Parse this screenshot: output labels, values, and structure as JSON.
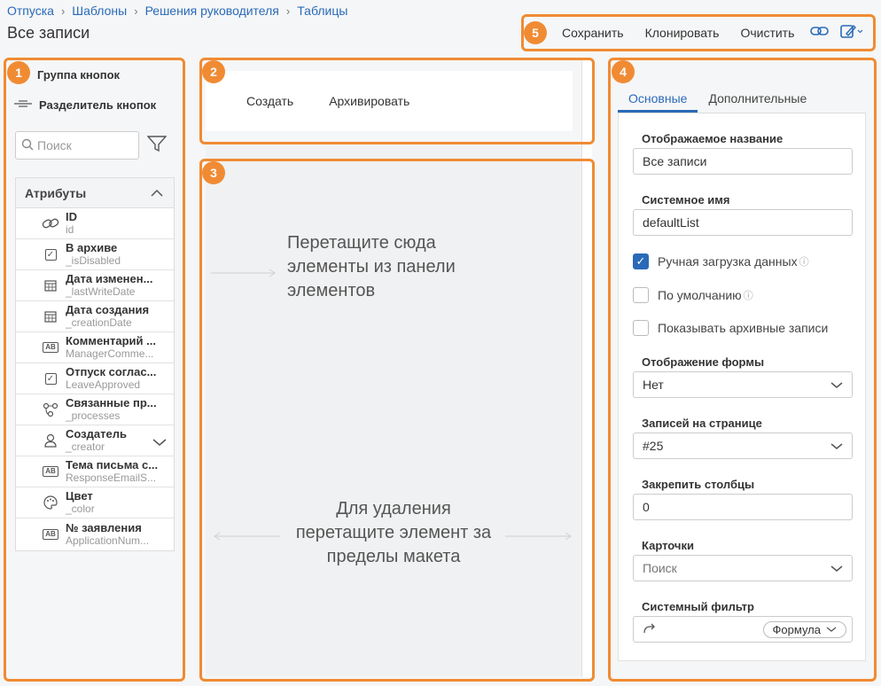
{
  "breadcrumb": [
    "Отпуска",
    "Шаблоны",
    "Решения руководителя",
    "Таблицы"
  ],
  "page_title": "Все записи",
  "toolbar": {
    "save": "Сохранить",
    "clone": "Клонировать",
    "clear": "Очистить"
  },
  "badges": [
    "1",
    "2",
    "3",
    "4",
    "5"
  ],
  "left": {
    "button_group": "Группа кнопок",
    "button_separator": "Разделитель кнопок",
    "search_placeholder": "Поиск",
    "attributes_title": "Атрибуты",
    "attributes": [
      {
        "name": "ID",
        "sys": "id",
        "icon": "link-icon"
      },
      {
        "name": "В архиве",
        "sys": "_isDisabled",
        "icon": "checkbox-icon"
      },
      {
        "name": "Дата изменен...",
        "sys": "_lastWriteDate",
        "icon": "calendar-icon"
      },
      {
        "name": "Дата создания",
        "sys": "_creationDate",
        "icon": "calendar-icon"
      },
      {
        "name": "Комментарий ...",
        "sys": "ManagerComme...",
        "icon": "text-ab-icon"
      },
      {
        "name": "Отпуск соглас...",
        "sys": "LeaveApproved",
        "icon": "checkbox-icon"
      },
      {
        "name": "Связанные пр...",
        "sys": "_processes",
        "icon": "process-icon"
      },
      {
        "name": "Создатель",
        "sys": "_creator",
        "icon": "user-icon"
      },
      {
        "name": "Тема письма с...",
        "sys": "ResponseEmailS...",
        "icon": "text-ab-icon"
      },
      {
        "name": "Цвет",
        "sys": "_color",
        "icon": "palette-icon"
      },
      {
        "name": "№ заявления",
        "sys": "ApplicationNum...",
        "icon": "text-ab-icon"
      }
    ]
  },
  "middle": {
    "buttons": [
      "Создать",
      "Архивировать"
    ],
    "drop_hint": "Перетащите сюда элементы из панели элементов",
    "drop_hint_lines": [
      "Перетащите сюда",
      "элементы из панели",
      "элементов"
    ],
    "delete_hint_lines": [
      "Для удаления",
      "перетащите элемент за",
      "пределы макета"
    ]
  },
  "right": {
    "tabs": [
      "Основные",
      "Дополнительные"
    ],
    "display_name_label": "Отображаемое название",
    "display_name_value": "Все записи",
    "system_name_label": "Системное имя",
    "system_name_value": "defaultList",
    "manual_load": "Ручная загрузка данных",
    "default": "По умолчанию",
    "show_archived": "Показывать архивные записи",
    "form_display_label": "Отображение формы",
    "form_display_value": "Нет",
    "per_page_label": "Записей на странице",
    "per_page_value": "#25",
    "pin_columns_label": "Закрепить столбцы",
    "pin_columns_value": "0",
    "cards_label": "Карточки",
    "cards_placeholder": "Поиск",
    "system_filter_label": "Системный фильтр",
    "formula_button": "Формула"
  },
  "colors": {
    "accent": "#2a6ab8",
    "highlight": "#f08b33"
  }
}
